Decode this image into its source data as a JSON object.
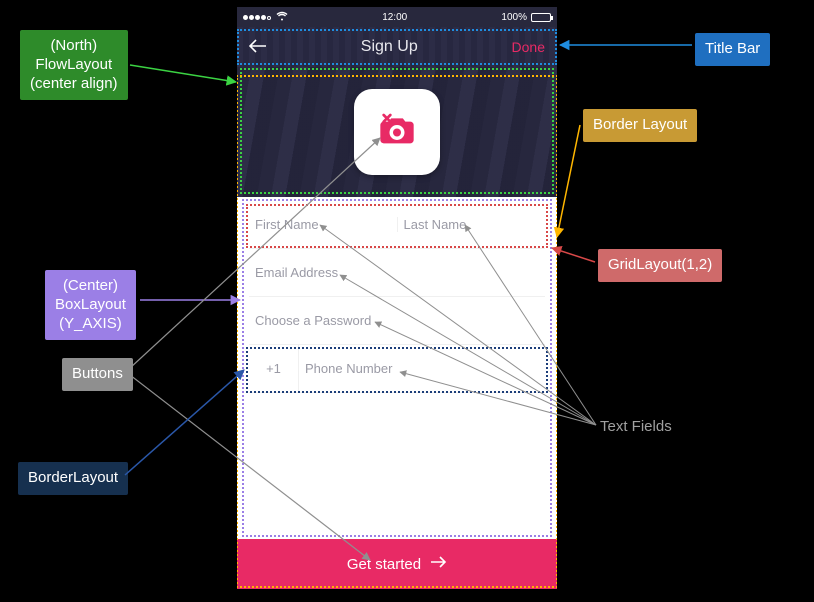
{
  "statusbar": {
    "time": "12:00",
    "battery": "100%",
    "carrier_dots": "●●●●○"
  },
  "titlebar": {
    "title": "Sign Up",
    "done": "Done"
  },
  "form": {
    "first_name": "First Name",
    "last_name": "Last Name",
    "email": "Email Address",
    "password": "Choose a Password",
    "country_code": "+1",
    "phone": "Phone Number"
  },
  "cta": {
    "label": "Get started"
  },
  "annotations": {
    "titlebar": "Title Bar",
    "flowlayout": "(North)\nFlowLayout\n(center align)",
    "border_layout_right": "Border Layout",
    "grid12": "GridLayout(1,2)",
    "boxlayout": "(Center)\nBoxLayout\n(Y_AXIS)",
    "buttons": "Buttons",
    "borderlayout_left": "BorderLayout",
    "text_fields": "Text Fields"
  },
  "colors": {
    "pink": "#e82a65",
    "green": "#3bd243",
    "yellow": "#ffb600",
    "blue_title": "#1f6fc0",
    "red": "#d84848",
    "navy": "#16304f",
    "purple": "#9b7fe6",
    "gray": "#8f8f8f"
  }
}
